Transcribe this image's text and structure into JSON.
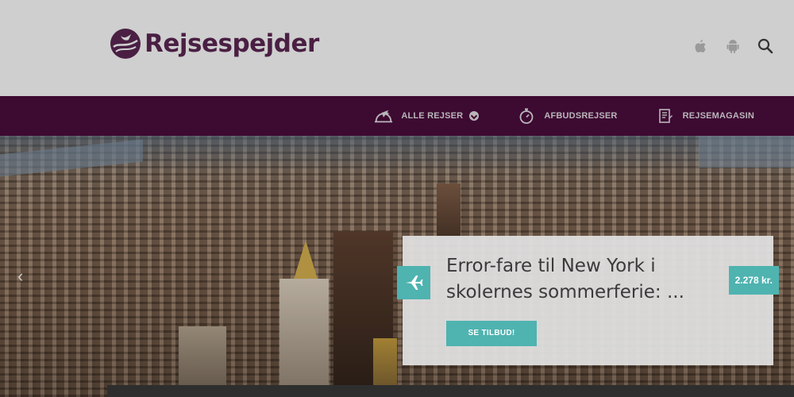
{
  "header": {
    "brand": "Rejsespejder",
    "icons": [
      "apple-icon",
      "android-icon",
      "search-icon"
    ]
  },
  "nav": {
    "items": [
      {
        "label": "ALLE REJSER",
        "icon": "plane-sunset-icon",
        "has_dropdown": true
      },
      {
        "label": "AFBUDSREJSER",
        "icon": "stopwatch-icon",
        "has_dropdown": false
      },
      {
        "label": "REJSEMAGASIN",
        "icon": "magazine-icon",
        "has_dropdown": false
      }
    ]
  },
  "hero": {
    "slider_prev": "‹",
    "card": {
      "title": "Error-fare til New York i skolernes sommerferie: ...",
      "price": "2.278 kr.",
      "cta": "SE TILBUD!",
      "icon": "plane-icon"
    }
  },
  "colors": {
    "brand": "#4a1f43",
    "nav_bg": "#3d0a32",
    "accent": "#4fb3b0",
    "header_bg": "#cfcfcf"
  }
}
